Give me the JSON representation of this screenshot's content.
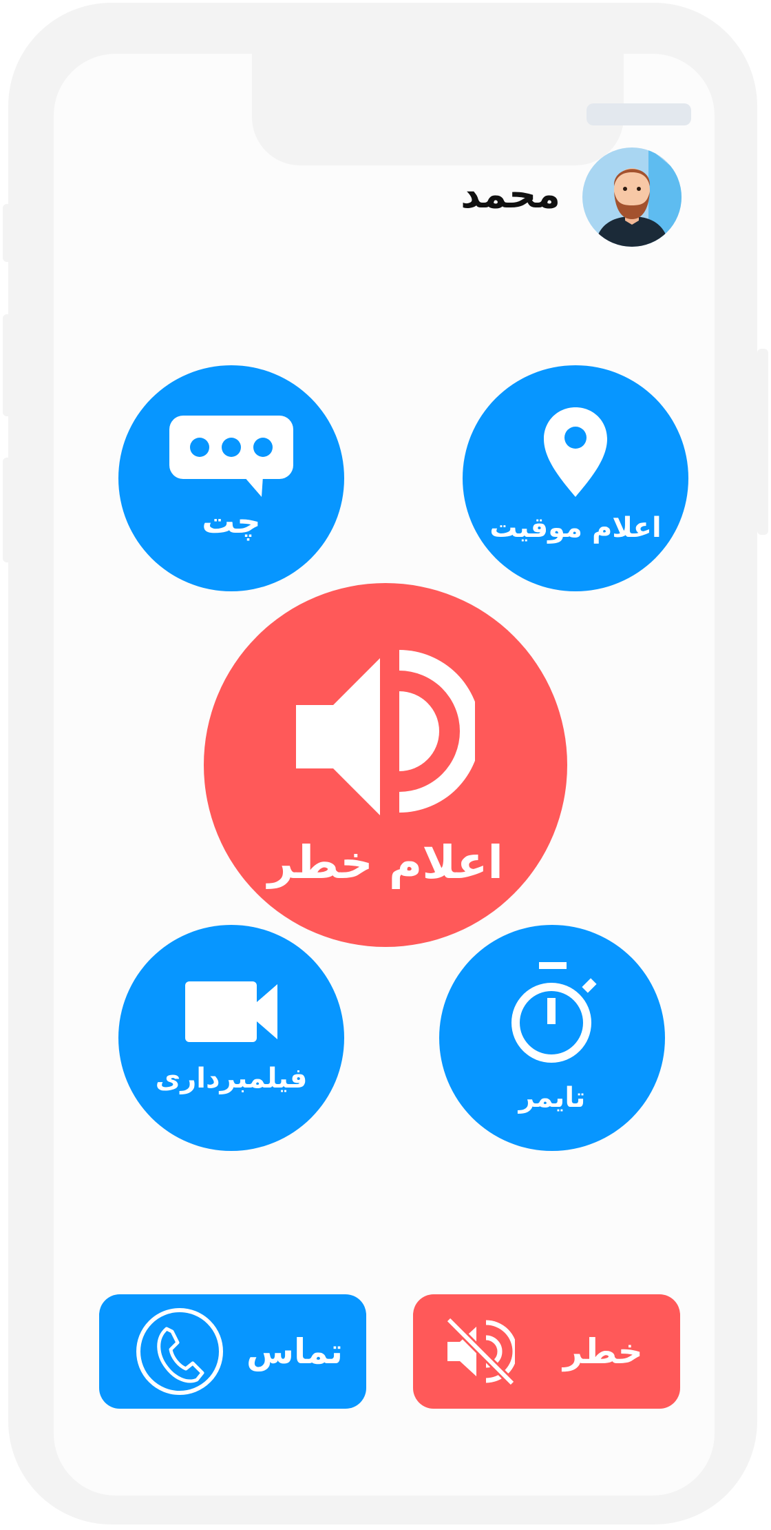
{
  "profile": {
    "name": "محمد",
    "avatar_icon": "bearded-man-avatar"
  },
  "actions": {
    "chat": {
      "label": "چت",
      "icon": "chat-bubble-icon"
    },
    "location": {
      "label": "اعلام موقیت",
      "icon": "location-pin-icon"
    },
    "alarm": {
      "label": "اعلام خطر",
      "icon": "speaker-icon"
    },
    "video": {
      "label": "فیلمبرداری",
      "icon": "video-camera-icon"
    },
    "timer": {
      "label": "تایمر",
      "icon": "stopwatch-icon"
    }
  },
  "bottom": {
    "call": {
      "label": "تماس",
      "icon": "phone-icon"
    },
    "danger": {
      "label": "خطر",
      "icon": "speaker-muted-icon"
    }
  },
  "colors": {
    "blue": "#0796ff",
    "red": "#ff5959",
    "frame": "#f3f3f3"
  }
}
